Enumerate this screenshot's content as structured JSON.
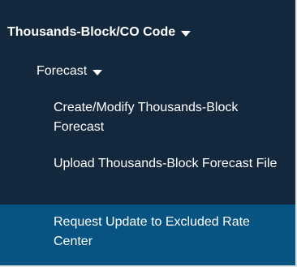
{
  "menu": {
    "section_label": "Thousands-Block/CO Code",
    "subsection_label": "Forecast",
    "items": [
      {
        "label": "Create/Modify Thousands-Block Forecast"
      },
      {
        "label": "Upload Thousands-Block Forecast File"
      },
      {
        "label": "Request Update to Excluded Rate Center"
      }
    ],
    "icons": {
      "section_caret": "caret-down-icon",
      "subsection_caret": "caret-down-icon"
    },
    "colors": {
      "background": "#13283d",
      "active_item_background": "#075483",
      "text": "#ffffff"
    }
  }
}
